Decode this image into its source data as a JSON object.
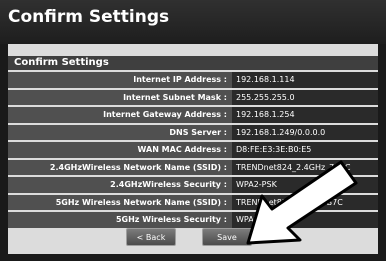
{
  "page": {
    "title": "Confirm Settings"
  },
  "panel": {
    "header": "Confirm Settings"
  },
  "settings": [
    {
      "label": "Internet IP Address :",
      "value": "192.168.1.114"
    },
    {
      "label": "Internet Subnet Mask :",
      "value": "255.255.255.0"
    },
    {
      "label": "Internet Gateway Address :",
      "value": "192.168.1.254"
    },
    {
      "label": "DNS Server :",
      "value": "192.168.1.249/0.0.0.0"
    },
    {
      "label": "WAN MAC Address :",
      "value": "D8:FE:E3:3E:B0:E5"
    },
    {
      "label": "2.4GHzWireless Network Name (SSID) :",
      "value": "TRENDnet824_2.4GHz_7B7C"
    },
    {
      "label": "2.4GHzWireless Security :",
      "value": "WPA2-PSK"
    },
    {
      "label": "5GHz Wireless Network Name (SSID) :",
      "value": "TRENDnet824_5GHz_7B7C"
    },
    {
      "label": "5GHz Wireless Security :",
      "value": "WPA2-PSK"
    }
  ],
  "buttons": {
    "back": "< Back",
    "save": "Save"
  },
  "annotation": {
    "arrow_color": "#ffffff",
    "arrow_outline": "#000000"
  }
}
